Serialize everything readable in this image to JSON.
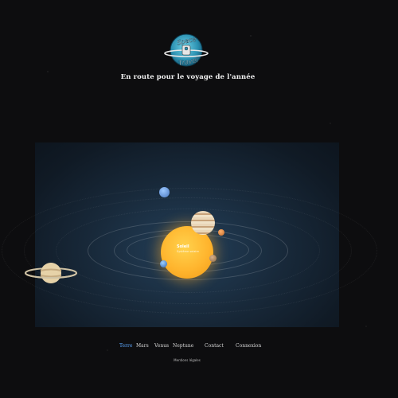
{
  "header": {
    "logo_text_top": "Space",
    "logo_text_bottom": "Travel",
    "tagline": "En route pour le voyage de l'année"
  },
  "scene": {
    "sun_title": "Soleil",
    "sun_subtitle": "Système solaire"
  },
  "nav": {
    "items": [
      {
        "label": "Terre",
        "active": true
      },
      {
        "label": "Mars",
        "active": false
      },
      {
        "label": "Venus",
        "active": false
      },
      {
        "label": "Neptune",
        "active": false
      },
      {
        "label": "Contact",
        "active": false
      },
      {
        "label": "Connexion",
        "active": false
      }
    ]
  },
  "footer": {
    "legal": "Mentions légales"
  },
  "colors": {
    "accent": "#5ea9ff",
    "sun": "#ffb52e",
    "background": "#0d0d0f"
  }
}
